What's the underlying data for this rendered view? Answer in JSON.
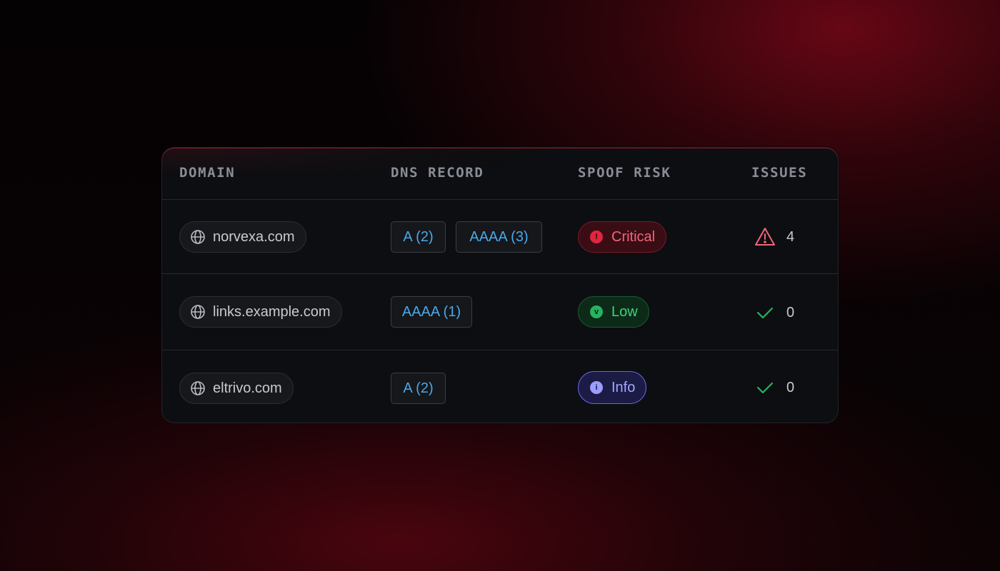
{
  "table": {
    "headers": {
      "domain": "DOMAIN",
      "dns_record": "DNS RECORD",
      "spoof_risk": "SPOOF RISK",
      "issues": "ISSUES"
    },
    "rows": [
      {
        "domain": "norvexa.com",
        "records": [
          "A (2)",
          "AAAA (3)"
        ],
        "risk": {
          "label": "Critical",
          "level": "critical",
          "dot_glyph": "!"
        },
        "issues": {
          "icon": "warning-triangle-icon",
          "count": "4"
        }
      },
      {
        "domain": "links.example.com",
        "records": [
          "AAAA (1)"
        ],
        "risk": {
          "label": "Low",
          "level": "low",
          "dot_glyph": "v"
        },
        "issues": {
          "icon": "checkmark-icon",
          "count": "0"
        }
      },
      {
        "domain": "eltrivo.com",
        "records": [
          "A (2)"
        ],
        "risk": {
          "label": "Info",
          "level": "info",
          "dot_glyph": "i"
        },
        "issues": {
          "icon": "checkmark-icon",
          "count": "0"
        }
      }
    ]
  },
  "colors": {
    "record_text": "#4aa8ea",
    "critical": "#f0657a",
    "low": "#3fd47c",
    "info": "#a5a7ff",
    "warning_icon": "#f0657a",
    "check_icon": "#27b35f"
  }
}
